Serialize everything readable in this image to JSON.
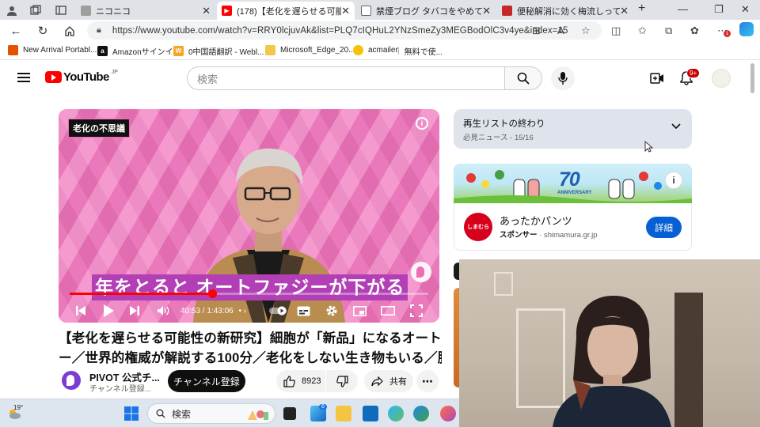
{
  "browser": {
    "tabs": [
      {
        "title": "ニコニコ",
        "active": false,
        "favicon_color": "#9e9e9e"
      },
      {
        "title": "(178)【老化を遅らせる可能性の新研究",
        "active": true,
        "favicon_color": "#ff0000"
      },
      {
        "title": "禁煙ブログ タバコをやめて10年！",
        "active": false,
        "favicon_color": "#ffffff"
      },
      {
        "title": "便秘解消に効く梅流しって？その",
        "active": false,
        "favicon_color": "#c62828"
      }
    ],
    "url": "https://www.youtube.com/watch?v=RRY0lcjuvAk&list=PLQ7cIQHuL2YNzSmeZy3MEGBodOlC3v4ye&index=15",
    "favorites": [
      {
        "label": "New Arrival Portabl...",
        "icon_color": "#e65100",
        "icon_glyph": ""
      },
      {
        "label": "Amazonサインイン",
        "icon_color": "#111111",
        "icon_glyph": "a"
      },
      {
        "label": "0中国語翻訳 - Webl...",
        "icon_color": "#f5a623",
        "icon_glyph": "W"
      },
      {
        "label": "Microsoft_Edge_20...",
        "icon_color": "#f3c74a",
        "icon_glyph": ""
      },
      {
        "label": "acmailer",
        "icon_color": "#f4c20d",
        "icon_glyph": ""
      },
      {
        "label": "無料で使...",
        "icon_color": "",
        "icon_glyph": ""
      }
    ],
    "extension_badge": "1"
  },
  "youtube": {
    "logo_text": "YouTube",
    "logo_region": "JP",
    "search_placeholder": "検索",
    "notification_count": "9+"
  },
  "player": {
    "overlay_tag": "老化の不思議",
    "caption": "年をとると オートファジーが下がる",
    "current_time": "40:53",
    "duration": "1:43:06",
    "time_separator": " / ",
    "progress_fraction": 0.397
  },
  "video": {
    "title_line1": "【老化を遅らせる可能性の新研究】細胞が「新品」になるオートファジ",
    "title_line2": "ー／世界的権威が解説する100分／老化をしない生き物もいる／脳科"
  },
  "channel": {
    "name": "PIVOT 公式チ...",
    "subscribers": "チャンネル登録...",
    "subscribe_label": "チャンネル登録",
    "like_count": "8923",
    "share_label": "共有"
  },
  "playlist": {
    "title": "再生リストの終わり",
    "subtitle": "必見ニュース - 15/16"
  },
  "ad": {
    "banner_number": "70",
    "banner_text": "ANNIVERSARY",
    "title": "あったかパンツ",
    "sponsor_label": "スポンサー",
    "domain": "shimamura.gr.jp",
    "button_label": "詳細",
    "logo_text": "しまむら"
  },
  "taskbar": {
    "temperature": "19°",
    "search_label": "検索",
    "badge_count": "6"
  },
  "colors": {
    "yt_red": "#ff0000",
    "subscribe_bg": "#0f0f0f",
    "ad_button": "#065fd4",
    "player_pink": "#f27dc1"
  }
}
